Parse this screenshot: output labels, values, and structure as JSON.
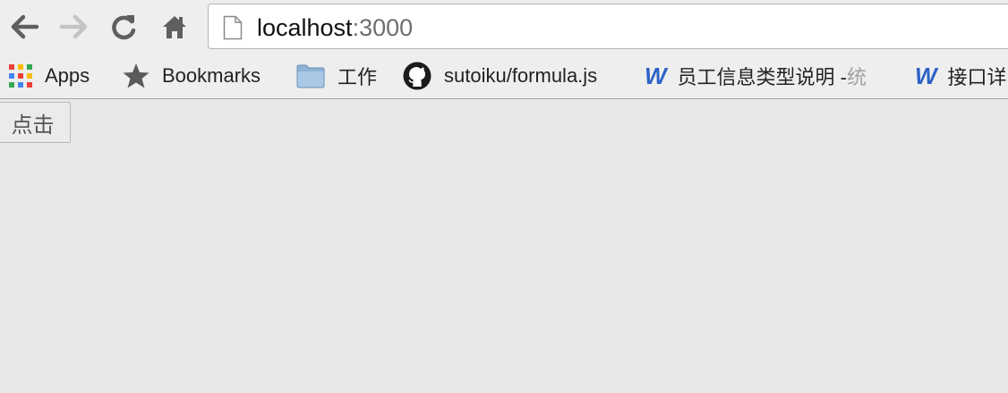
{
  "browser": {
    "url_host": "localhost",
    "url_port": ":3000"
  },
  "bookmarks": [
    {
      "label": "Apps",
      "icon": "apps-grid-icon"
    },
    {
      "label": "Bookmarks",
      "icon": "star-icon"
    },
    {
      "label": "工作",
      "icon": "folder-icon"
    },
    {
      "label": "sutoiku/formula.js",
      "icon": "github-icon"
    },
    {
      "label": "员工信息类型说明 - ",
      "label_fade": "统",
      "icon": "w-icon"
    },
    {
      "label": "接口详",
      "icon": "w-icon"
    }
  ],
  "page": {
    "button_label": "点击"
  },
  "colors": {
    "toolbar_bg": "#eeeeee",
    "page_bg": "#e6e8e9",
    "word_icon": "#2b63c7"
  }
}
